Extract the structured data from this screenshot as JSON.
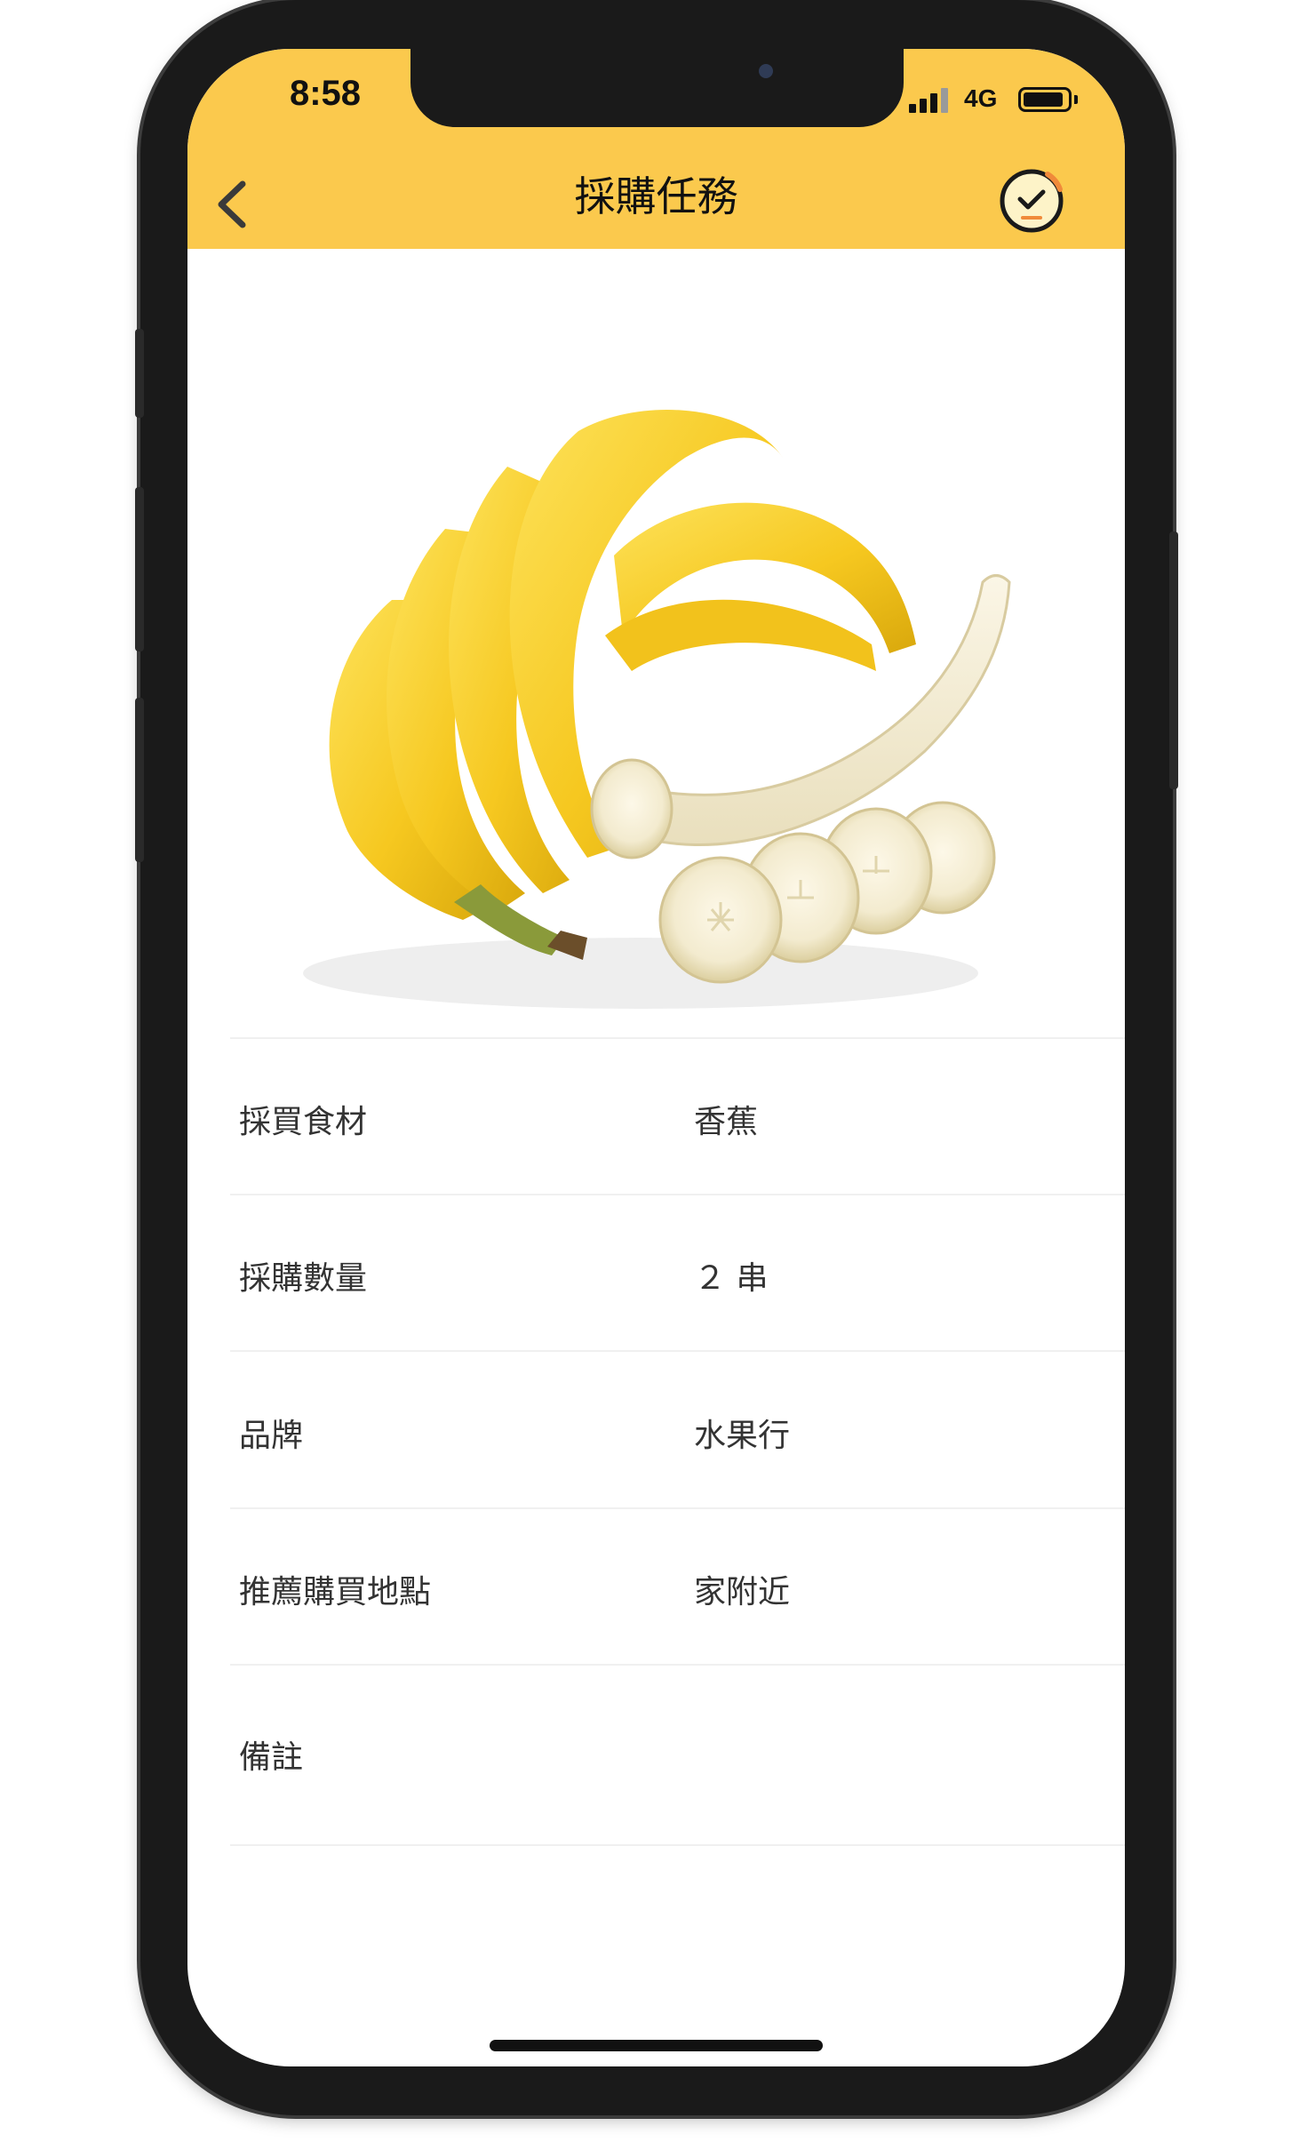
{
  "status_bar": {
    "time": "8:58",
    "network": "4G"
  },
  "header": {
    "title": "採購任務"
  },
  "icons": {
    "back": "chevron-left-icon",
    "done": "check-circle-icon",
    "signal": "signal-icon",
    "battery": "battery-icon",
    "product_image": "banana-image"
  },
  "colors": {
    "header_bg": "#fbc94d",
    "text": "#333333"
  },
  "details": {
    "rows": [
      {
        "label": "採買食材",
        "value": "香蕉"
      },
      {
        "label": "採購數量",
        "value": "２ 串"
      },
      {
        "label": "品牌",
        "value": "水果行"
      },
      {
        "label": "推薦購買地點",
        "value": "家附近"
      },
      {
        "label": "備註",
        "value": ""
      }
    ]
  }
}
